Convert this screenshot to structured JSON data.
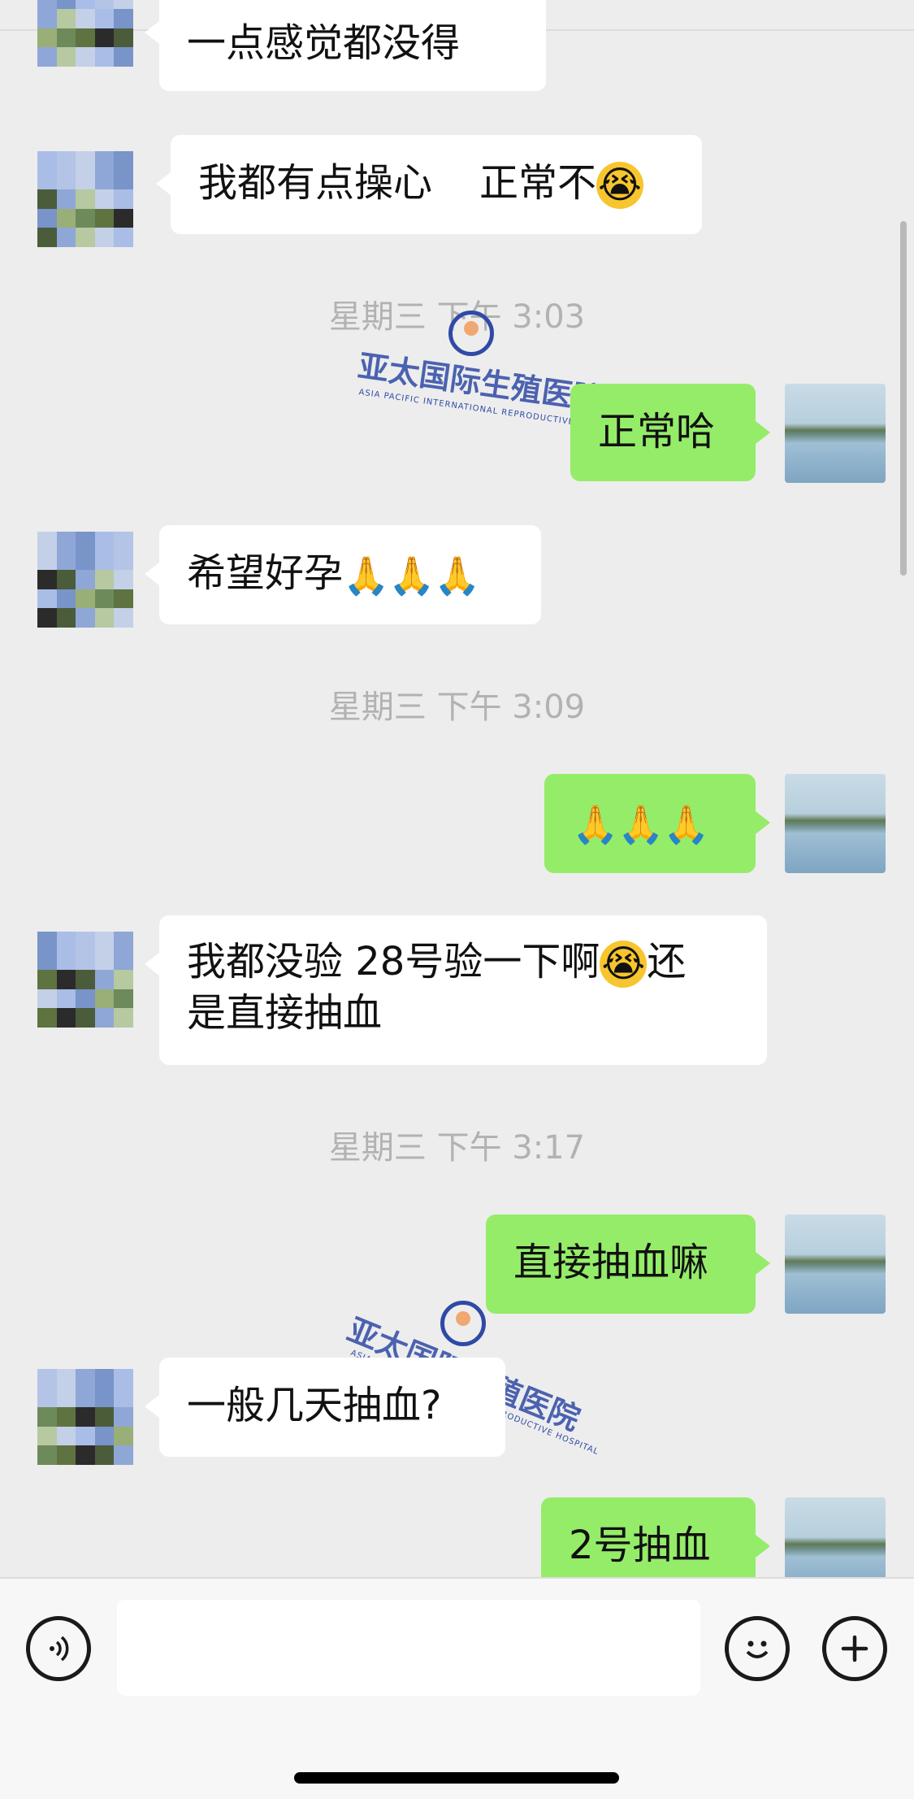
{
  "timestamps": [
    "星期三 下午 3:03",
    "星期三 下午 3:09",
    "星期三 下午 3:17"
  ],
  "messages": {
    "m1": "一点感觉都没得",
    "m2": "我都有点操心",
    "m2b": "正常不",
    "m3": "正常哈",
    "m4": "希望好孕",
    "m6a": "我都没验  28号验一下啊",
    "m6b": "还",
    "m6c": "是直接抽血",
    "m7": "直接抽血嘛",
    "m8": "一般几天抽血?",
    "m9": "2号抽血"
  },
  "emoji": {
    "cry": "😭",
    "pray": "🙏"
  },
  "watermark": {
    "text": "亚太国际生殖医院",
    "subtext": "ASIA PACIFIC INTERNATIONAL REPRODUCTIVE HOSPITAL"
  },
  "icons": {
    "voice": "voice-input-icon",
    "emoji": "emoji-icon",
    "plus": "plus-icon"
  },
  "colors": {
    "background": "#ededed",
    "incoming_bubble": "#ffffff",
    "outgoing_bubble": "#95ec69",
    "timestamp": "#b2b2b2",
    "watermark": "#2f4aa6"
  }
}
